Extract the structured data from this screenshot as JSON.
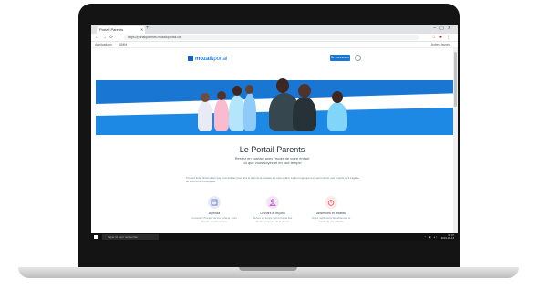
{
  "browser": {
    "tab_title": "Portail Parents",
    "url": "https://portailparents.mozaikportail.ca",
    "bookmarks": [
      "Applications",
      "SIMM"
    ],
    "bookmarks_right": "Autres favoris"
  },
  "site": {
    "logo_brand": "mozaik",
    "logo_suffix": "portal",
    "connect_label": "Se connecter",
    "title": "Le Portail Parents",
    "subtitle_line1": "Restez en contact avec l'école de votre enfant",
    "subtitle_line2": "où que vous soyez et en tout temps!",
    "paragraph": "Trouvez toute l'information que vous désirez pour faire le suivi de la réussite de votre enfant. Le tout regroupé à un seul endroit, peu importe qu'il s'agisse du fiche ou de l'entreprise.",
    "features": [
      {
        "title": "Agenda",
        "desc": "Consultez l'horaire de vos enfants, leurs devoirs et leurs leçons.",
        "color": "#5c6bc0",
        "icon": "calendar-icon"
      },
      {
        "title": "Devoirs et leçons",
        "desc": "Suivez en temps réel le travail des devoirs et leçons de la classe.",
        "color": "#ab47bc",
        "icon": "person-icon"
      },
      {
        "title": "Absences et retards",
        "desc": "Voyez rapidement les absences et retards de vos enfants.",
        "color": "#ef5350",
        "icon": "alarm-icon"
      }
    ]
  },
  "taskbar": {
    "search_placeholder": "Taper ici pour rechercher",
    "time": "11:07",
    "date": "2019-05-14"
  }
}
